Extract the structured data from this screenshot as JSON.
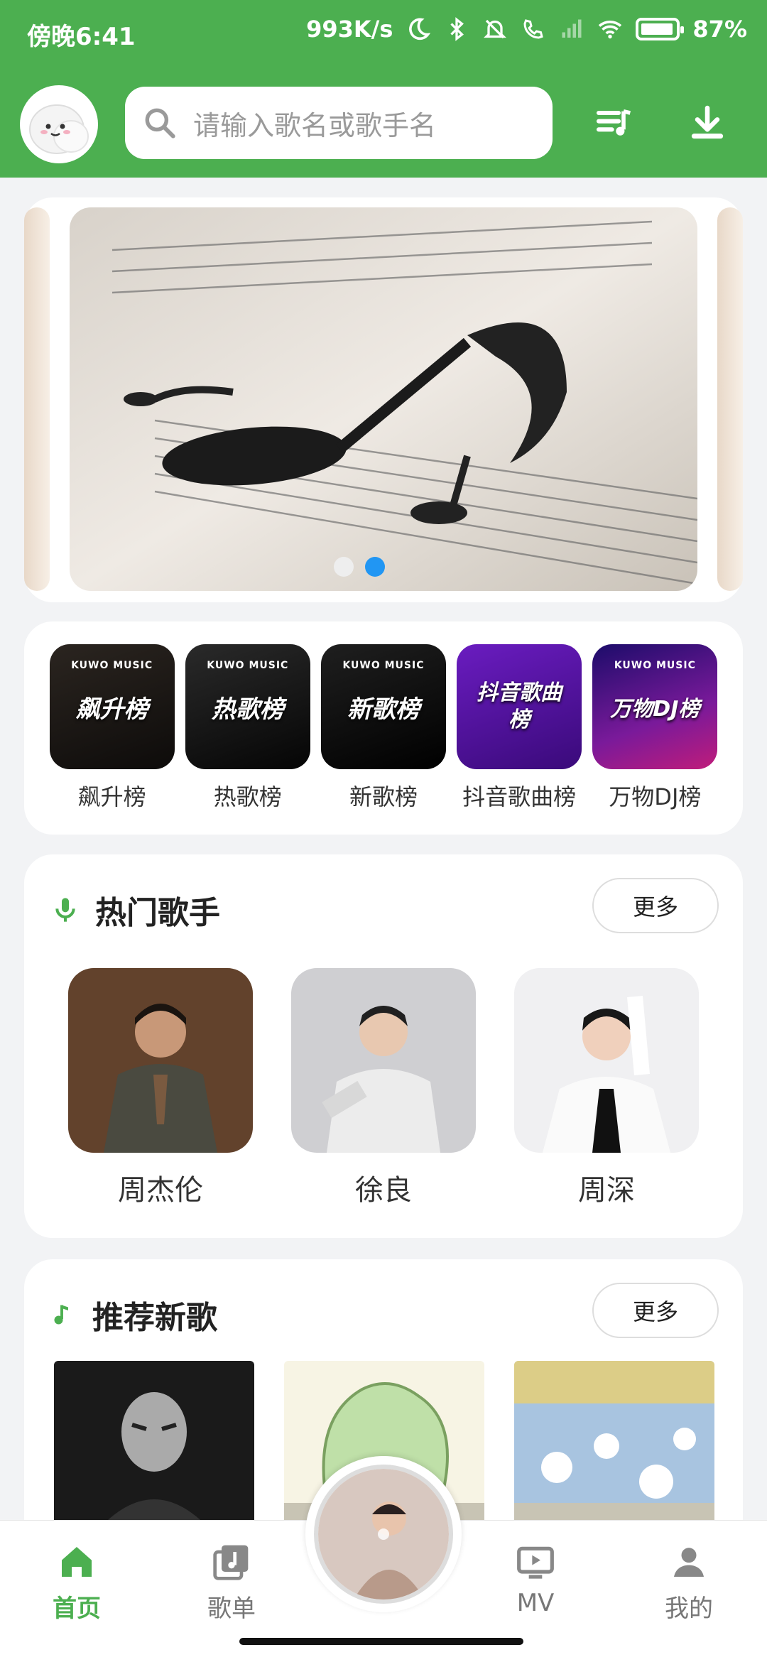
{
  "status_bar": {
    "time": "傍晚6:41",
    "net_speed": "993K/s",
    "battery": "87%"
  },
  "header": {
    "search_placeholder": "请输入歌名或歌手名",
    "icons": [
      "app-logo",
      "search-icon",
      "playlist-icon",
      "download-icon"
    ]
  },
  "banner": {
    "slide_count": 2,
    "active_index": 1
  },
  "charts": [
    {
      "label": "飙升榜",
      "cover_text": "飙升榜",
      "brand": "KUWO MUSIC"
    },
    {
      "label": "热歌榜",
      "cover_text": "热歌榜",
      "brand": "KUWO MUSIC"
    },
    {
      "label": "新歌榜",
      "cover_text": "新歌榜",
      "brand": "KUWO MUSIC"
    },
    {
      "label": "抖音歌曲榜",
      "cover_text": "抖音歌曲榜",
      "brand": ""
    },
    {
      "label": "万物DJ榜",
      "cover_text": "万物DJ榜",
      "brand": "KUWO MUSIC"
    }
  ],
  "hot_singers": {
    "title": "热门歌手",
    "more": "更多",
    "items": [
      {
        "name": "周杰伦"
      },
      {
        "name": "徐良"
      },
      {
        "name": "周深"
      }
    ]
  },
  "new_songs": {
    "title": "推荐新歌",
    "more": "更多"
  },
  "bottom_nav": {
    "items": [
      {
        "label": "首页",
        "icon": "home-icon",
        "active": true
      },
      {
        "label": "歌单",
        "icon": "music-album-icon",
        "active": false
      },
      {
        "label": "MV",
        "icon": "tv-play-icon",
        "active": false
      },
      {
        "label": "我的",
        "icon": "person-icon",
        "active": false
      }
    ]
  },
  "colors": {
    "brand": "#4caf50",
    "accent_dot": "#2196f3"
  }
}
